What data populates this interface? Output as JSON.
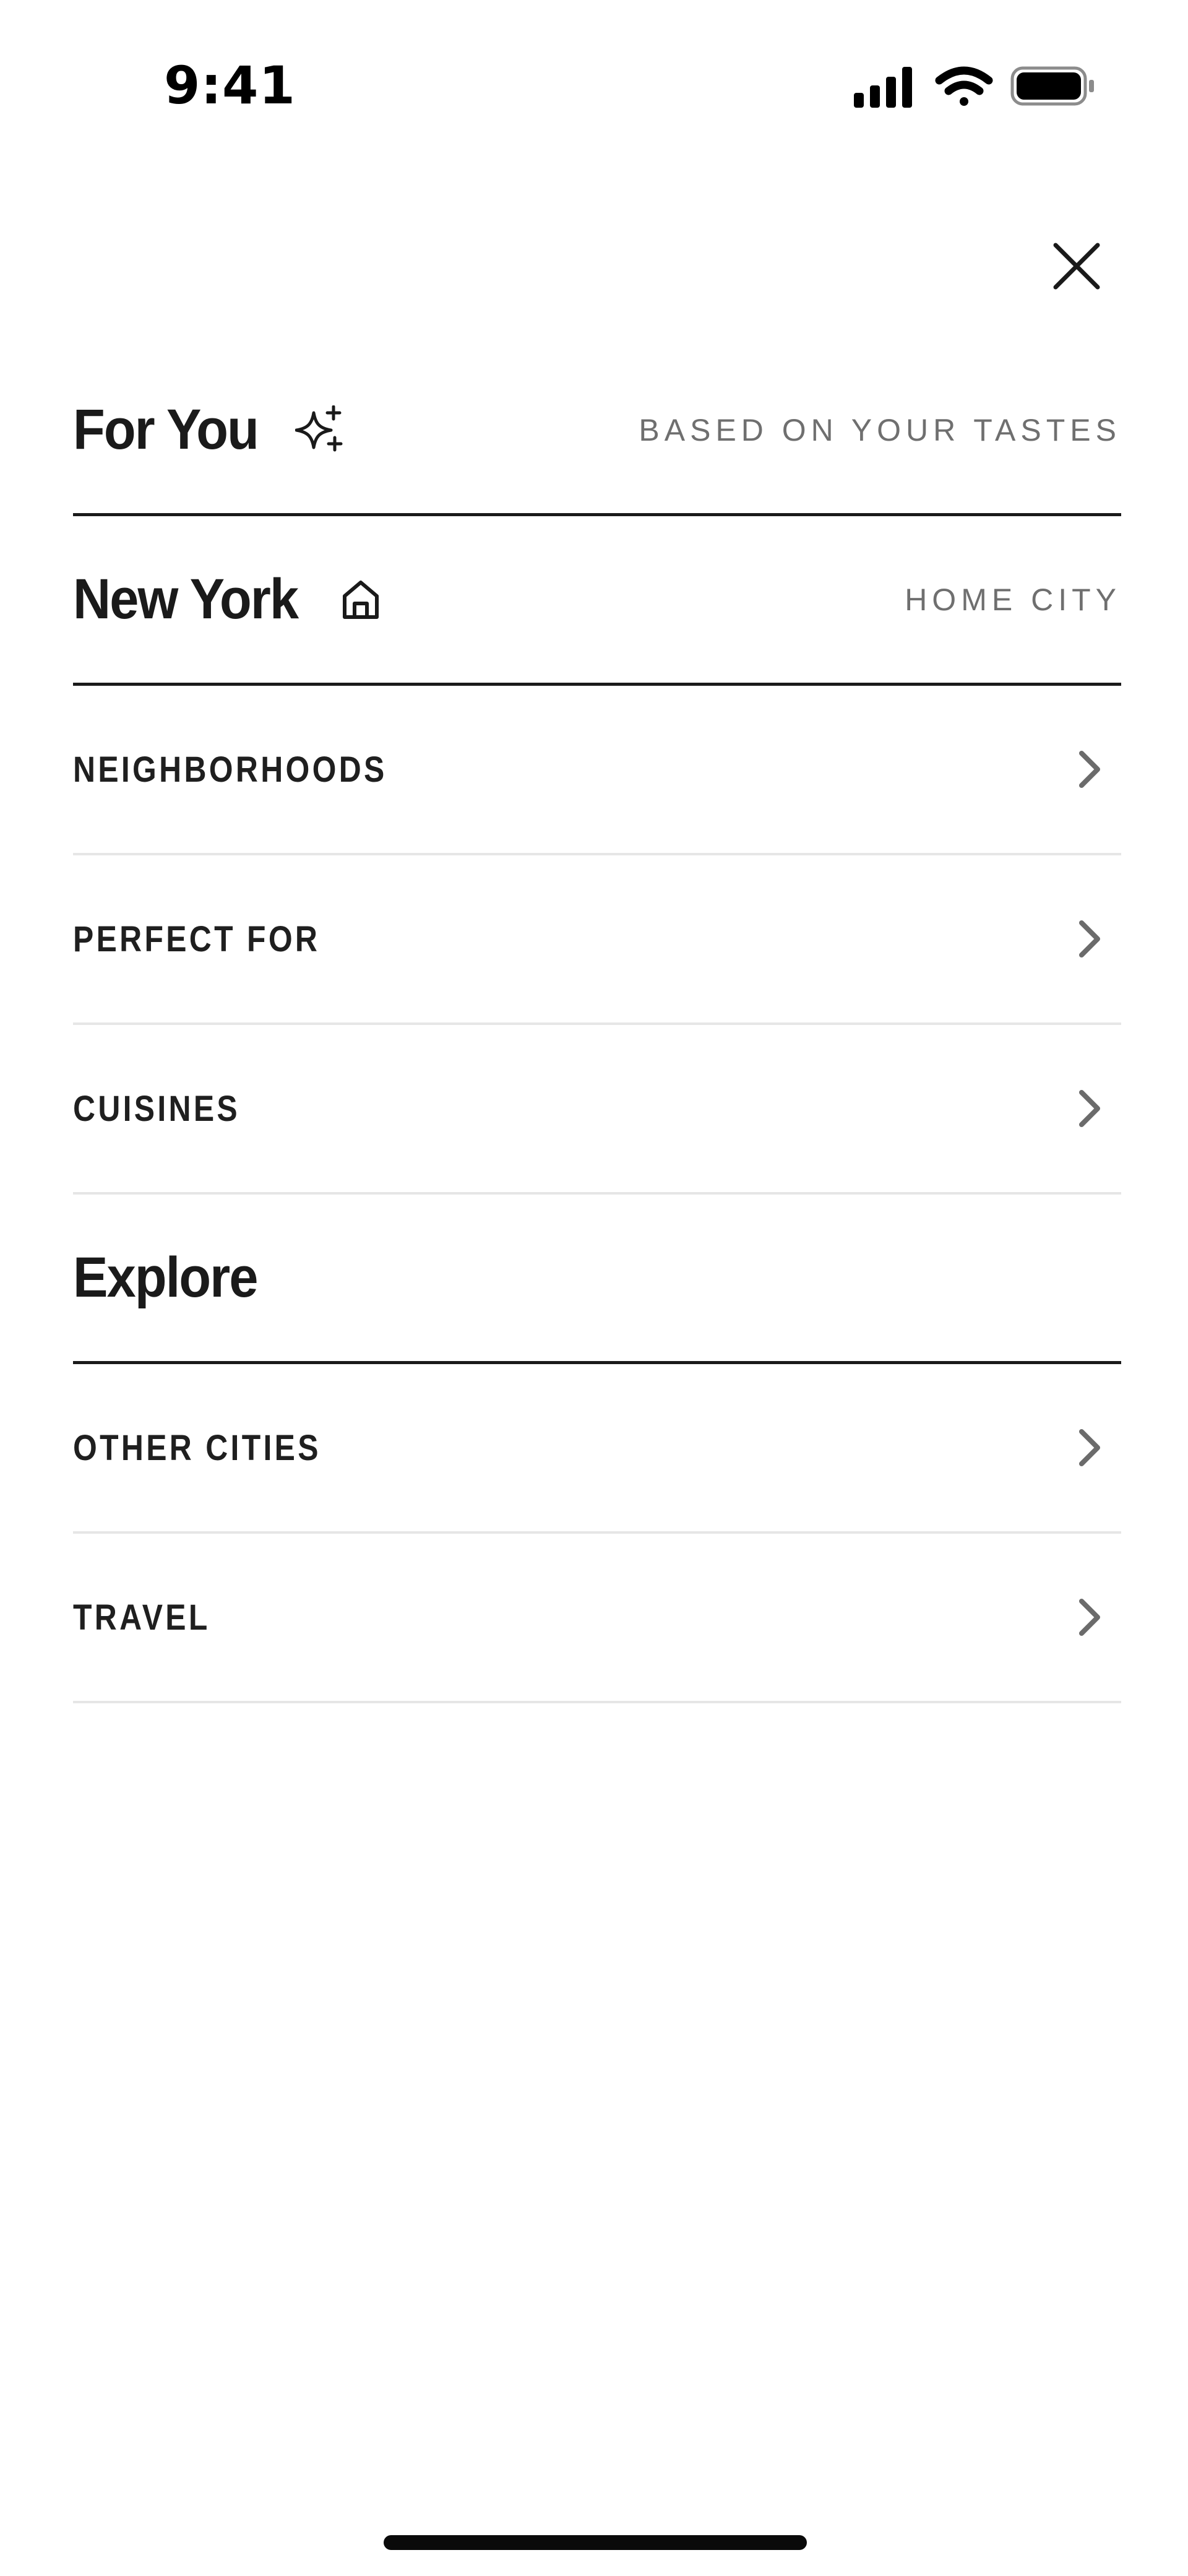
{
  "status_bar": {
    "time": "9:41"
  },
  "close": {
    "icon": "close-icon"
  },
  "menu": {
    "for_you": {
      "title": "For You",
      "icon": "sparkles-icon",
      "tag": "BASED ON YOUR TASTES"
    },
    "home_city": {
      "title": "New York",
      "icon": "home-icon",
      "tag": "HOME CITY"
    },
    "city_items": [
      {
        "label": "NEIGHBORHOODS",
        "icon": "chevron-right-icon"
      },
      {
        "label": "PERFECT FOR",
        "icon": "chevron-right-icon"
      },
      {
        "label": "CUISINES",
        "icon": "chevron-right-icon"
      }
    ],
    "explore": {
      "title": "Explore"
    },
    "explore_items": [
      {
        "label": "OTHER CITIES",
        "icon": "chevron-right-icon"
      },
      {
        "label": "TRAVEL",
        "icon": "chevron-right-icon"
      }
    ]
  },
  "colors": {
    "text": "#1a1a1a",
    "muted": "#6f6f6f",
    "divider_heavy": "#1a1a1a",
    "divider_light": "#e6e6e6",
    "chevron": "#6b6b6b"
  }
}
